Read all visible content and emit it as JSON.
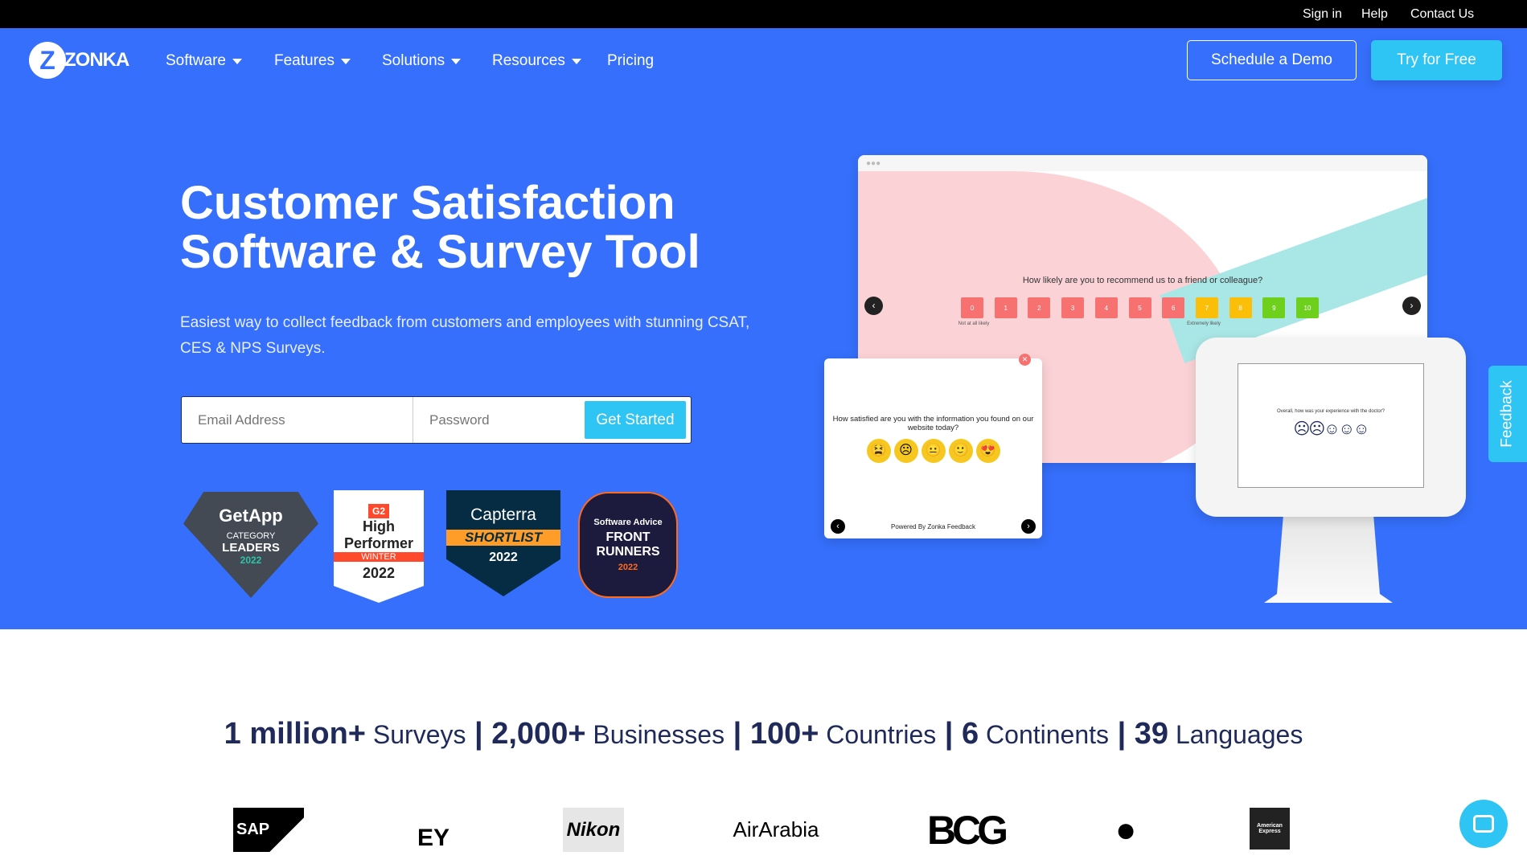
{
  "topbar": {
    "sign_in": "Sign in",
    "help": "Help",
    "contact": "Contact Us"
  },
  "brand": {
    "logo_text": "ZONKA"
  },
  "nav": {
    "items": [
      {
        "label": "Software"
      },
      {
        "label": "Features"
      },
      {
        "label": "Solutions"
      },
      {
        "label": "Resources"
      },
      {
        "label": "Pricing"
      }
    ],
    "schedule_demo": "Schedule a Demo",
    "try_free": "Try for Free"
  },
  "hero": {
    "title_line1": "Customer Satisfaction",
    "title_line2": "Software & Survey Tool",
    "subtitle": "Easiest way to collect feedback from customers and employees with stunning CSAT, CES & NPS Surveys.",
    "email_placeholder": "Email Address",
    "password_placeholder": "Password",
    "get_started": "Get Started"
  },
  "badges": [
    {
      "brand": "GetApp",
      "line1": "CATEGORY",
      "line2": "LEADERS",
      "year": "2022"
    },
    {
      "brand": "G2",
      "line1": "High",
      "line2": "Performer",
      "season": "WINTER",
      "year": "2022"
    },
    {
      "brand": "Capterra",
      "line1": "SHORTLIST",
      "year": "2022"
    },
    {
      "brand": "Software Advice",
      "line1": "FRONT",
      "line2": "RUNNERS",
      "year": "2022"
    }
  ],
  "mockup": {
    "nps_question": "How likely are you to recommend us to a friend or colleague?",
    "nps_scale": [
      "0",
      "1",
      "2",
      "3",
      "4",
      "5",
      "6",
      "7",
      "8",
      "9",
      "10"
    ],
    "nps_low": "Not at all likely",
    "nps_high": "Extremely likely",
    "popup_question": "How satisfied are you with the information you found on our website today?",
    "popup_footer": "Powered By Zonka Feedback",
    "kiosk_question": "Overall, how was your experience with the doctor?"
  },
  "feedback_tab": "Feedback",
  "stats": [
    {
      "num": "1 million+",
      "label": "Surveys"
    },
    {
      "num": "2,000+",
      "label": "Businesses"
    },
    {
      "num": "100+",
      "label": "Countries"
    },
    {
      "num": "6",
      "label": "Continents"
    },
    {
      "num": "39",
      "label": "Languages"
    }
  ],
  "clients": [
    "SAP",
    "EY",
    "Nikon",
    "AirArabia",
    "BCG",
    "Apple",
    "American Express"
  ],
  "colors": {
    "hero": "#356ffb",
    "cta": "#2ec4f4",
    "text_dark": "#1f2a5a",
    "nps_red": "#f87171",
    "nps_yellow": "#fbbf0a",
    "nps_green": "#6fcf1d"
  }
}
